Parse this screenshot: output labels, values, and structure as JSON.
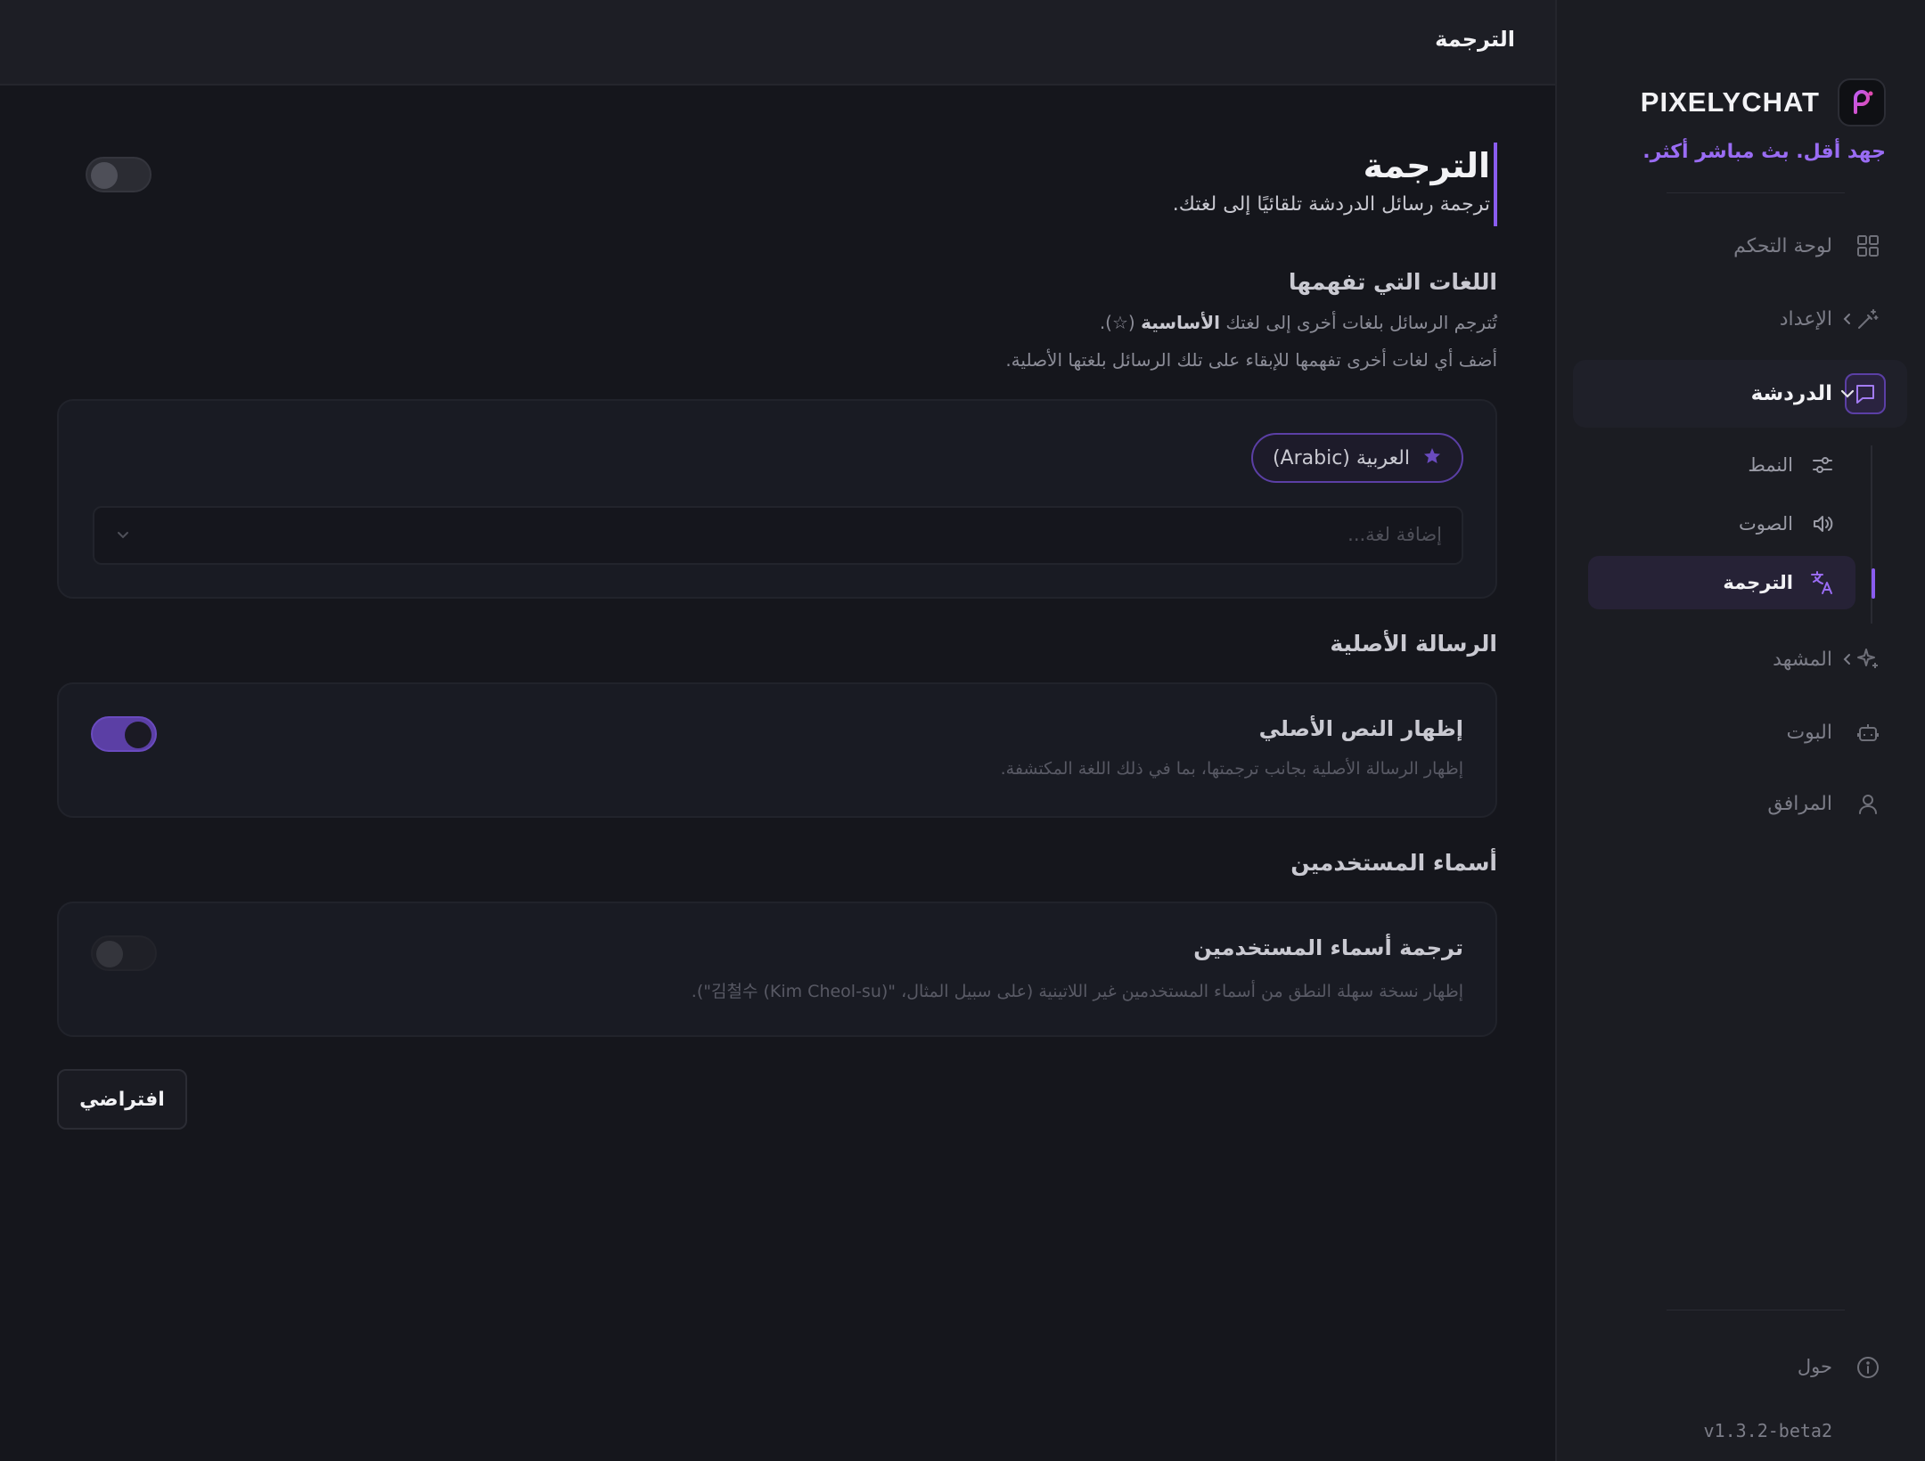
{
  "topbar": {
    "title": "الترجمة"
  },
  "brand": {
    "name": "PIXELYCHAT",
    "tagline": "جهد أقل. بث مباشر أكثر."
  },
  "sidebar": {
    "items": [
      {
        "label": "لوحة التحكم",
        "icon": "grid-icon"
      },
      {
        "label": "الإعداد",
        "icon": "wand-icon"
      },
      {
        "label": "الدردشة",
        "icon": "chat-icon"
      },
      {
        "label": "المشهد",
        "icon": "sparkle-icon"
      },
      {
        "label": "البوت",
        "icon": "robot-icon"
      },
      {
        "label": "المرافق",
        "icon": "user-icon"
      }
    ],
    "chat_subitems": [
      {
        "label": "النمط",
        "icon": "sliders-icon"
      },
      {
        "label": "الصوت",
        "icon": "speaker-icon"
      },
      {
        "label": "الترجمة",
        "icon": "translate-icon"
      }
    ],
    "about": "حول",
    "version": "v1.3.2-beta2"
  },
  "page": {
    "title": "الترجمة",
    "subtitle": "ترجمة رسائل الدردشة تلقائيًا إلى لغتك.",
    "enabled": false
  },
  "languages": {
    "title": "اللغات التي تفهمها",
    "desc1_pre": "تُترجم الرسائل بلغات أخرى إلى لغتك",
    "desc1_bold": "الأساسية",
    "desc1_post": "(☆).",
    "desc2": "أضف أي لغات أخرى تفهمها للإبقاء على تلك الرسائل بلغتها الأصلية.",
    "primary_chip": "العربية (Arabic)",
    "add_placeholder": "إضافة لغة..."
  },
  "original": {
    "section": "الرسالة الأصلية",
    "title": "إظهار النص الأصلي",
    "desc": "إظهار الرسالة الأصلية بجانب ترجمتها، بما في ذلك اللغة المكتشفة.",
    "enabled": true
  },
  "usernames": {
    "section": "أسماء المستخدمين",
    "title": "ترجمة أسماء المستخدمين",
    "desc": "إظهار نسخة سهلة النطق من أسماء المستخدمين غير اللاتينية (على سبيل المثال، \"김철수 (Kim Cheol-su)\").",
    "enabled": false
  },
  "default_button": "افتراضي",
  "colors": {
    "accent": "#8a5cf0",
    "background": "#15161c",
    "sidebar": "#1b1c22"
  }
}
